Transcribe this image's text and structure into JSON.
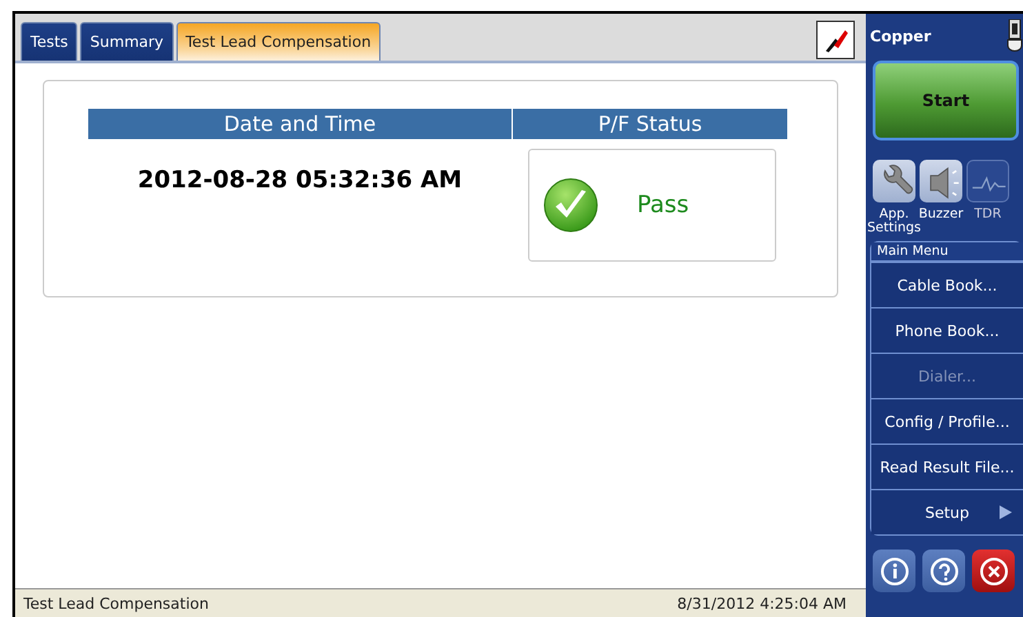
{
  "tabs": [
    {
      "label": "Tests",
      "selected": false
    },
    {
      "label": "Summary",
      "selected": false
    },
    {
      "label": "Test Lead Compensation",
      "selected": true
    }
  ],
  "result": {
    "columns": [
      "Date and Time",
      "P/F Status"
    ],
    "date_time": "2012-08-28 05:32:36 AM",
    "status": "Pass",
    "passed": true
  },
  "sidebar": {
    "title": "Copper",
    "start_button": "Start",
    "tools": [
      {
        "label": "App. Settings",
        "kind": "wrench",
        "disabled": false
      },
      {
        "label": "Buzzer",
        "kind": "speaker",
        "disabled": false
      },
      {
        "label": "TDR",
        "kind": "trace",
        "disabled": true
      }
    ],
    "menu_title": "Main Menu",
    "menu": [
      {
        "label": "Cable Book...",
        "disabled": false,
        "kind": "item"
      },
      {
        "label": "Phone Book...",
        "disabled": false,
        "kind": "item"
      },
      {
        "label": "Dialer...",
        "disabled": true,
        "kind": "item"
      },
      {
        "label": "Config / Profile...",
        "disabled": false,
        "kind": "item"
      },
      {
        "label": "Read Result File...",
        "disabled": false,
        "kind": "item"
      },
      {
        "label": "Setup",
        "disabled": false,
        "kind": "submenu"
      }
    ]
  },
  "status_bar": {
    "left": "Test Lead Compensation",
    "right": "8/31/2012 4:25:04 AM"
  }
}
